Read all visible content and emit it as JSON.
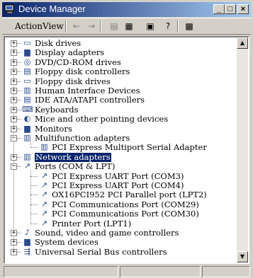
{
  "window": {
    "title": "Device Manager",
    "icon": "device-manager-icon",
    "minimize_glyph": "_",
    "maximize_glyph": "□",
    "close_glyph": "×"
  },
  "menu": {
    "action": "Action",
    "view": "View"
  },
  "toolbar": {
    "back_glyph": "←",
    "forward_glyph": "→",
    "tree_glyph": "▤",
    "list_glyph": "▦",
    "properties_glyph": "▣",
    "help_glyph": "?",
    "scan_glyph": "▩"
  },
  "scrollbar": {
    "up_glyph": "▲",
    "down_glyph": "▼"
  },
  "tree": [
    {
      "label": "Disk drives",
      "icon": "disk-drive-icon",
      "glyph": "▭",
      "level": 0,
      "state": "collapsed"
    },
    {
      "label": "Display adapters",
      "icon": "display-adapter-icon",
      "glyph": "▆",
      "level": 0,
      "state": "collapsed"
    },
    {
      "label": "DVD/CD-ROM drives",
      "icon": "dvd-drive-icon",
      "glyph": "◎",
      "level": 0,
      "state": "collapsed"
    },
    {
      "label": "Floppy disk controllers",
      "icon": "floppy-controller-icon",
      "glyph": "▤",
      "level": 0,
      "state": "collapsed"
    },
    {
      "label": "Floppy disk drives",
      "icon": "floppy-drive-icon",
      "glyph": "▭",
      "level": 0,
      "state": "collapsed"
    },
    {
      "label": "Human Interface Devices",
      "icon": "hid-icon",
      "glyph": "▥",
      "level": 0,
      "state": "collapsed"
    },
    {
      "label": "IDE ATA/ATAPI controllers",
      "icon": "ide-controller-icon",
      "glyph": "▤",
      "level": 0,
      "state": "collapsed"
    },
    {
      "label": "Keyboards",
      "icon": "keyboard-icon",
      "glyph": "⌨",
      "level": 0,
      "state": "collapsed"
    },
    {
      "label": "Mice and other pointing devices",
      "icon": "mouse-icon",
      "glyph": "◐",
      "level": 0,
      "state": "collapsed"
    },
    {
      "label": "Monitors",
      "icon": "monitor-icon",
      "glyph": "▆",
      "level": 0,
      "state": "collapsed"
    },
    {
      "label": "Multifunction adapters",
      "icon": "multifunction-adapter-icon",
      "glyph": "▥",
      "level": 0,
      "state": "expanded"
    },
    {
      "label": "PCI Express Multiport Serial Adapter",
      "icon": "serial-adapter-icon",
      "glyph": "▥",
      "level": 1,
      "state": "leaf"
    },
    {
      "label": "Network adapters",
      "icon": "network-adapter-icon",
      "glyph": "▥",
      "level": 0,
      "state": "collapsed",
      "selected": true
    },
    {
      "label": "Ports (COM & LPT)",
      "icon": "ports-icon",
      "glyph": "↗",
      "level": 0,
      "state": "expanded"
    },
    {
      "label": "PCI Express UART Port (COM3)",
      "icon": "port-icon",
      "glyph": "↗",
      "level": 1,
      "state": "leaf"
    },
    {
      "label": "PCI Express UART Port (COM4)",
      "icon": "port-icon",
      "glyph": "↗",
      "level": 1,
      "state": "leaf"
    },
    {
      "label": "OX16PCI952 PCI Parallel port (LPT2)",
      "icon": "port-icon",
      "glyph": "↗",
      "level": 1,
      "state": "leaf"
    },
    {
      "label": "PCI Communications Port (COM29)",
      "icon": "port-icon",
      "glyph": "↗",
      "level": 1,
      "state": "leaf"
    },
    {
      "label": "PCI Communications Port (COM30)",
      "icon": "port-icon",
      "glyph": "↗",
      "level": 1,
      "state": "leaf"
    },
    {
      "label": "Printer Port (LPT1)",
      "icon": "port-icon",
      "glyph": "↗",
      "level": 1,
      "state": "leaf"
    },
    {
      "label": "Sound, video and game controllers",
      "icon": "sound-icon",
      "glyph": "♪",
      "level": 0,
      "state": "collapsed"
    },
    {
      "label": "System devices",
      "icon": "system-devices-icon",
      "glyph": "▆",
      "level": 0,
      "state": "collapsed"
    },
    {
      "label": "Universal Serial Bus controllers",
      "icon": "usb-icon",
      "glyph": "⇶",
      "level": 0,
      "state": "collapsed"
    }
  ],
  "colors": {
    "titlebar_start": "#0a246a",
    "titlebar_end": "#a6caf0",
    "selection": "#0a246a",
    "face": "#d4d0c8"
  }
}
